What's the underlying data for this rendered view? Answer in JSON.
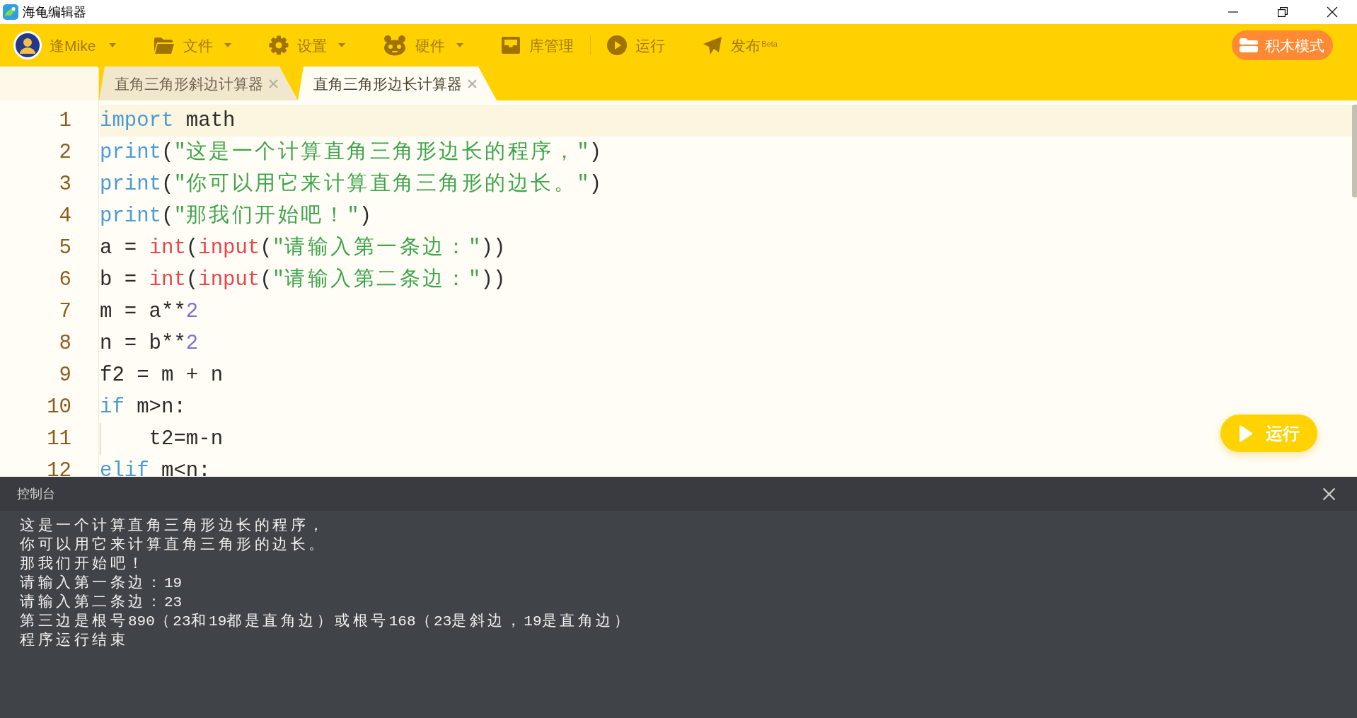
{
  "window": {
    "title": "海龟编辑器"
  },
  "toolbar": {
    "user": {
      "name": "逢Mike",
      "dropdown": true
    },
    "groups": [
      [
        {
          "label": "文件",
          "dropdown": true
        },
        {
          "label": "设置",
          "dropdown": true
        },
        {
          "label": "硬件",
          "dropdown": true
        },
        {
          "label": "库管理",
          "dropdown": false
        }
      ],
      [
        {
          "label": "运行",
          "dropdown": false
        },
        {
          "label": "发布$^{Beta}$",
          "dropdown": false
        }
      ]
    ],
    "mode_button": "积木模式"
  },
  "tabs": [
    {
      "label": "直角三角形斜边计算器",
      "selected": false
    },
    {
      "label": "直角三角形边长计算器",
      "selected": true
    }
  ],
  "editor": {
    "lines": [
      {
        "number": "1",
        "active": true,
        "tokens": [
          {
            "kind": "keyword",
            "text": "import"
          },
          {
            "kind": "plain",
            "text": " math"
          }
        ]
      },
      {
        "number": "2",
        "active": false,
        "tokens": [
          {
            "kind": "keyword",
            "text": "print"
          },
          {
            "kind": "plain",
            "text": "("
          },
          {
            "kind": "string",
            "text": "\"这是一个计算直角三角形边长的程序，\""
          },
          {
            "kind": "plain",
            "text": ")"
          }
        ]
      },
      {
        "number": "3",
        "active": false,
        "tokens": [
          {
            "kind": "keyword",
            "text": "print"
          },
          {
            "kind": "plain",
            "text": "("
          },
          {
            "kind": "string",
            "text": "\"你可以用它来计算直角三角形的边长。\""
          },
          {
            "kind": "plain",
            "text": ")"
          }
        ]
      },
      {
        "number": "4",
        "active": false,
        "tokens": [
          {
            "kind": "keyword",
            "text": "print"
          },
          {
            "kind": "plain",
            "text": "("
          },
          {
            "kind": "string",
            "text": "\"那我们开始吧！\""
          },
          {
            "kind": "plain",
            "text": ")"
          }
        ]
      },
      {
        "number": "5",
        "active": false,
        "tokens": [
          {
            "kind": "plain",
            "text": "a = "
          },
          {
            "kind": "function",
            "text": "int"
          },
          {
            "kind": "plain",
            "text": "("
          },
          {
            "kind": "function",
            "text": "input"
          },
          {
            "kind": "plain",
            "text": "("
          },
          {
            "kind": "string",
            "text": "\"请输入第一条边：\""
          },
          {
            "kind": "plain",
            "text": "))"
          }
        ]
      },
      {
        "number": "6",
        "active": false,
        "tokens": [
          {
            "kind": "plain",
            "text": "b = "
          },
          {
            "kind": "function",
            "text": "int"
          },
          {
            "kind": "plain",
            "text": "("
          },
          {
            "kind": "function",
            "text": "input"
          },
          {
            "kind": "plain",
            "text": "("
          },
          {
            "kind": "string",
            "text": "\"请输入第二条边：\""
          },
          {
            "kind": "plain",
            "text": "))"
          }
        ]
      },
      {
        "number": "7",
        "active": false,
        "tokens": [
          {
            "kind": "plain",
            "text": "m = a**"
          },
          {
            "kind": "number",
            "text": "2"
          }
        ]
      },
      {
        "number": "8",
        "active": false,
        "tokens": [
          {
            "kind": "plain",
            "text": "n = b**"
          },
          {
            "kind": "number",
            "text": "2"
          }
        ]
      },
      {
        "number": "9",
        "active": false,
        "tokens": [
          {
            "kind": "plain",
            "text": "f2 = m + n"
          }
        ]
      },
      {
        "number": "10",
        "active": false,
        "tokens": [
          {
            "kind": "keyword",
            "text": "if"
          },
          {
            "kind": "plain",
            "text": " m>n:"
          }
        ]
      },
      {
        "number": "11",
        "active": false,
        "tokens": [
          {
            "kind": "plain",
            "text": "    t2=m-n"
          }
        ]
      },
      {
        "number": "12",
        "active": false,
        "tokens": [
          {
            "kind": "keyword",
            "text": "elif"
          },
          {
            "kind": "plain",
            "text": " m<n:"
          }
        ]
      }
    ],
    "run_button": "运行"
  },
  "console": {
    "title": "控制台",
    "lines": [
      "这是一个计算直角三角形边长的程序，",
      "你可以用它来计算直角三角形的边长。",
      "那我们开始吧！",
      "请输入第一条边：19",
      "请输入第二条边：23",
      "第三边是根号890（23和19都是直角边）或根号168（23是斜边，19是直角边）",
      "程序运行结束"
    ]
  }
}
